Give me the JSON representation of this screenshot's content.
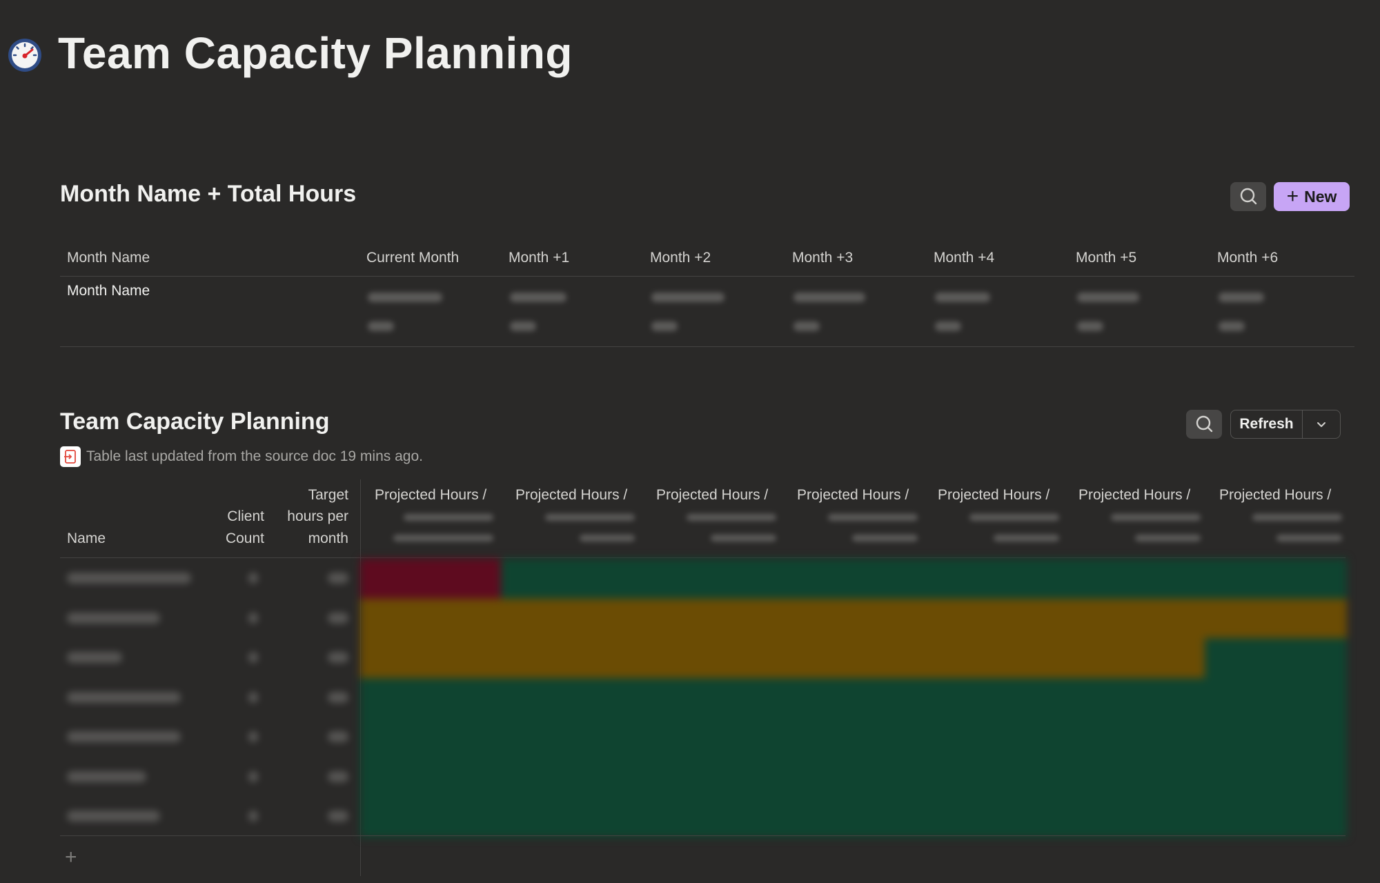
{
  "page": {
    "title": "Team Capacity Planning",
    "icon": "speedometer-icon"
  },
  "section1": {
    "title": "Month Name + Total Hours",
    "search_icon": "search-icon",
    "new_label": "New",
    "columns": [
      "Month Name",
      "Current Month",
      "Month +1",
      "Month +2",
      "Month +3",
      "Month +4",
      "Month +5",
      "Month +6"
    ],
    "row_label": "Month Name"
  },
  "section2": {
    "title": "Team Capacity Planning",
    "refresh_label": "Refresh",
    "updated_text": "Table last updated from the source doc 19 mins ago.",
    "columns": {
      "name": "Name",
      "client_count_1": "Client",
      "client_count_2": "Count",
      "target_1": "Target",
      "target_2": "hours per",
      "target_3": "month",
      "projected": "Projected Hours /"
    },
    "row_count": 7,
    "heatmap_colors": {
      "red": "#5e0b1f",
      "green": "#0f4430",
      "amber": "#6b4c04"
    },
    "heatmap_rows": [
      [
        "red",
        "green",
        "green",
        "green",
        "green",
        "green",
        "green"
      ],
      [
        "amber",
        "amber",
        "amber",
        "amber",
        "amber",
        "amber",
        "amber"
      ],
      [
        "amber",
        "amber",
        "amber",
        "amber",
        "amber",
        "amber",
        "green"
      ],
      [
        "green",
        "green",
        "green",
        "green",
        "green",
        "green",
        "green"
      ],
      [
        "green",
        "green",
        "green",
        "green",
        "green",
        "green",
        "green"
      ],
      [
        "green",
        "green",
        "green",
        "green",
        "green",
        "green",
        "green"
      ],
      [
        "green",
        "green",
        "green",
        "green",
        "green",
        "green",
        "green"
      ]
    ]
  }
}
